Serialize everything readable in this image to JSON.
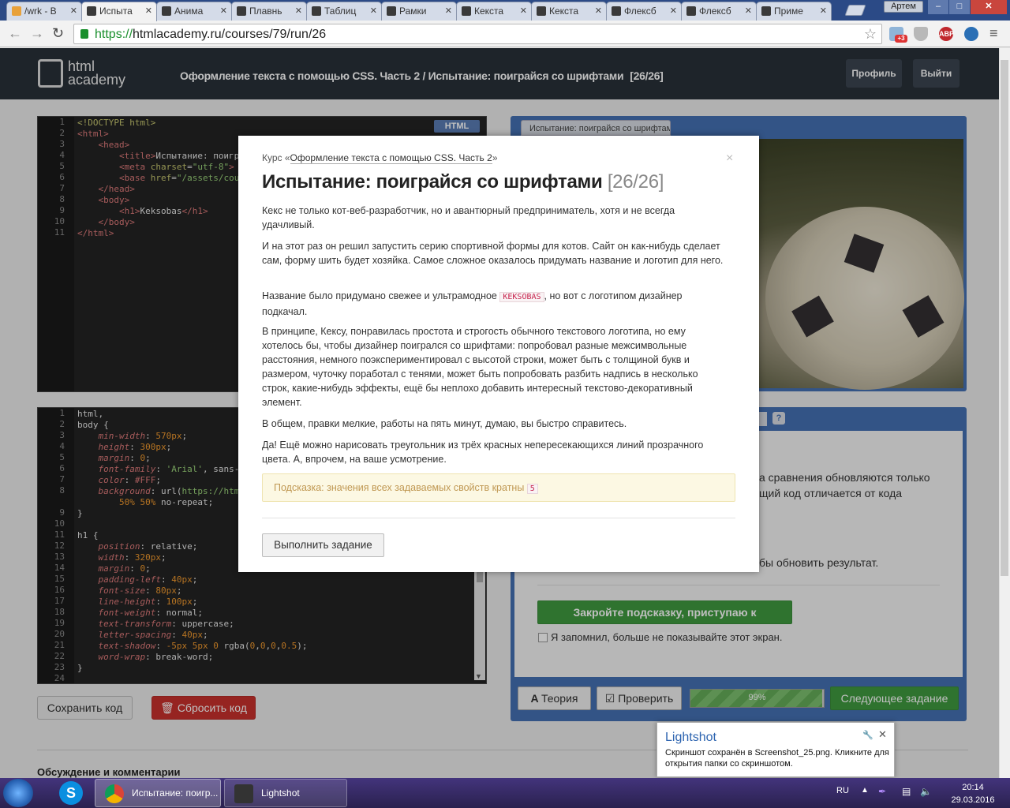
{
  "browser": {
    "tabs": [
      {
        "label": "/wrk - В",
        "icon": "spark-icon"
      },
      {
        "label": "Испыта",
        "icon": "academy-icon",
        "active": true
      },
      {
        "label": "Анима",
        "icon": "academy-icon"
      },
      {
        "label": "Плавнь",
        "icon": "academy-icon"
      },
      {
        "label": "Таблиц",
        "icon": "academy-icon"
      },
      {
        "label": "Рамки",
        "icon": "academy-icon"
      },
      {
        "label": "Кекста",
        "icon": "academy-icon"
      },
      {
        "label": "Кекста",
        "icon": "academy-icon"
      },
      {
        "label": "Флексб",
        "icon": "academy-icon"
      },
      {
        "label": "Флексб",
        "icon": "academy-icon"
      },
      {
        "label": "Приме",
        "icon": "academy-icon"
      }
    ],
    "user": "Артем",
    "url_scheme": "https://",
    "url_rest": "htmlacademy.ru/courses/79/run/26",
    "ext_badge": "+3",
    "abp": "ABP"
  },
  "site": {
    "logo_line1": "html",
    "logo_line2": "academy",
    "breadcrumb": "Оформление текста с помощью CSS. Часть 2 / Испытание: поиграйся со шрифтами",
    "counter": "[26/26]",
    "profile": "Профиль",
    "logout": "Выйти"
  },
  "html_editor": {
    "badge": "HTML",
    "lines": [
      "1",
      "2",
      "3",
      "4",
      "5",
      "6",
      "7",
      "8",
      "9",
      "10",
      "11"
    ]
  },
  "css_editor": {
    "lines": [
      "1",
      "2",
      "3",
      "4",
      "5",
      "6",
      "7",
      "8",
      "",
      "9",
      "10",
      "11",
      "12",
      "13",
      "14",
      "15",
      "16",
      "17",
      "18",
      "19",
      "20",
      "21",
      "22",
      "23",
      "24"
    ]
  },
  "buttons": {
    "save": "Сохранить код",
    "reset": "Сбросить код"
  },
  "preview": {
    "tab": "Испытание: поиграйся со шрифтами"
  },
  "lower": {
    "help": "?",
    "text1": "а сравнения обновляются только",
    "text2": "щий код отличается от кода",
    "text3": "бы обновить результат.",
    "got_it": "Закройте подсказку, приступаю к испытанию!",
    "remember": "Я запомнил, больше не показывайте этот экран.",
    "theory": "Теория",
    "check": "Проверить",
    "progress_label": "99%",
    "progress_value": 0.99,
    "next": "Следующее задание"
  },
  "comments_title": "Обсуждение и комментарии",
  "modal": {
    "course_prefix": "Курс «",
    "course_link": "Оформление текста с помощью CSS. Часть 2",
    "course_suffix": "»",
    "close": "×",
    "title": "Испытание: поиграйся со шрифтами",
    "counter": "[26/26]",
    "p1": "Кекс не только кот-веб-разработчик, но и авантюрный предприниматель, хотя и не всегда удачливый.",
    "p2": "И на этот раз он решил запустить серию спортивной формы для котов. Сайт он как-нибудь сделает сам, форму шить будет хозяйка. Самое сложное оказалось придумать название и логотип для него.",
    "p3_before": "Название было придумано свежее и ультрамодное",
    "p3_code": "KEKSOBAS",
    "p3_after": ", но вот с логотипом дизайнер подкачал.",
    "p4": "В принципе, Кексу, понравилась простота и строгость обычного текстового логотипа, но ему хотелось бы, чтобы дизайнер поигрался со шрифтами: попробовал разные межсимвольные расстояния, немного поэкспериментировал с высотой строки, может быть с толщиной букв и размером, чуточку поработал с тенями, может быть попробовать разбить надпись в несколько строк, какие-нибудь эффекты, ещё бы неплохо добавить интересный текстово-декоративный элемент.",
    "p5": "В общем, правки мелкие, работы на пять минут, думаю, вы быстро справитесь.",
    "p6": "Да! Ещё можно нарисовать треугольник из трёх красных непересекающихся линий прозрачного цвета. А, впрочем, на ваше усмотрение.",
    "hint_text": "Подсказка: значения всех задаваемых свойств кратны",
    "hint_code": "5",
    "do_task": "Выполнить задание"
  },
  "toast": {
    "title": "Lightshot",
    "message": "Скриншот сохранён в Screenshot_25.png. Кликните для открытия папки со скриншотом."
  },
  "taskbar": {
    "chrome_label": "Испытание: поигр...",
    "lightshot_label": "Lightshot",
    "lang": "RU",
    "time": "20:14",
    "date": "29.03.2016"
  }
}
